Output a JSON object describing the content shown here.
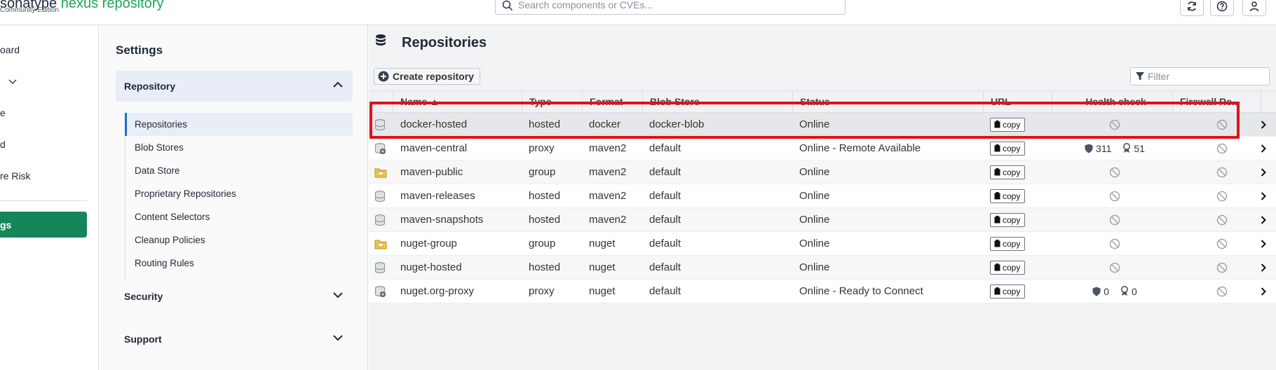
{
  "brand": {
    "name_part1": "sonatype",
    "name_part2": "nexus repository",
    "edition": "Community Edition"
  },
  "search": {
    "placeholder": "Search components or CVEs..."
  },
  "leftnav": {
    "items": [
      "oard",
      "e",
      "d",
      "re Risk"
    ],
    "active_label": "gs"
  },
  "settings": {
    "title": "Settings",
    "sections": {
      "repository": "Repository",
      "security": "Security",
      "support": "Support"
    },
    "items": [
      "Repositories",
      "Blob Stores",
      "Data Store",
      "Proprietary Repositories",
      "Content Selectors",
      "Cleanup Policies",
      "Routing Rules"
    ]
  },
  "main": {
    "title": "Repositories",
    "create_label": "Create repository",
    "filter_placeholder": "Filter",
    "columns": {
      "name": "Name",
      "type": "Type",
      "format": "Format",
      "blob": "Blob Store",
      "status": "Status",
      "url": "URL",
      "health": "Health check",
      "firewall": "Firewall Re..."
    },
    "copy_label": "copy",
    "rows": [
      {
        "name": "docker-hosted",
        "type": "hosted",
        "format": "docker",
        "blob": "docker-blob",
        "status": "Online",
        "kind": "hosted",
        "selected": true
      },
      {
        "name": "maven-central",
        "type": "proxy",
        "format": "maven2",
        "blob": "default",
        "status": "Online - Remote Available",
        "kind": "proxy",
        "health_security": "311",
        "health_license": "51"
      },
      {
        "name": "maven-public",
        "type": "group",
        "format": "maven2",
        "blob": "default",
        "status": "Online",
        "kind": "group"
      },
      {
        "name": "maven-releases",
        "type": "hosted",
        "format": "maven2",
        "blob": "default",
        "status": "Online",
        "kind": "hosted"
      },
      {
        "name": "maven-snapshots",
        "type": "hosted",
        "format": "maven2",
        "blob": "default",
        "status": "Online",
        "kind": "hosted"
      },
      {
        "name": "nuget-group",
        "type": "group",
        "format": "nuget",
        "blob": "default",
        "status": "Online",
        "kind": "group"
      },
      {
        "name": "nuget-hosted",
        "type": "hosted",
        "format": "nuget",
        "blob": "default",
        "status": "Online",
        "kind": "hosted"
      },
      {
        "name": "nuget.org-proxy",
        "type": "proxy",
        "format": "nuget",
        "blob": "default",
        "status": "Online - Ready to Connect",
        "kind": "proxy",
        "health_security": "0",
        "health_license": "0"
      }
    ]
  },
  "colors": {
    "brand_green": "#22a55a",
    "active_nav": "#17855a",
    "highlight": "#e0121b",
    "selected_item_bar": "#1b6fcf"
  }
}
